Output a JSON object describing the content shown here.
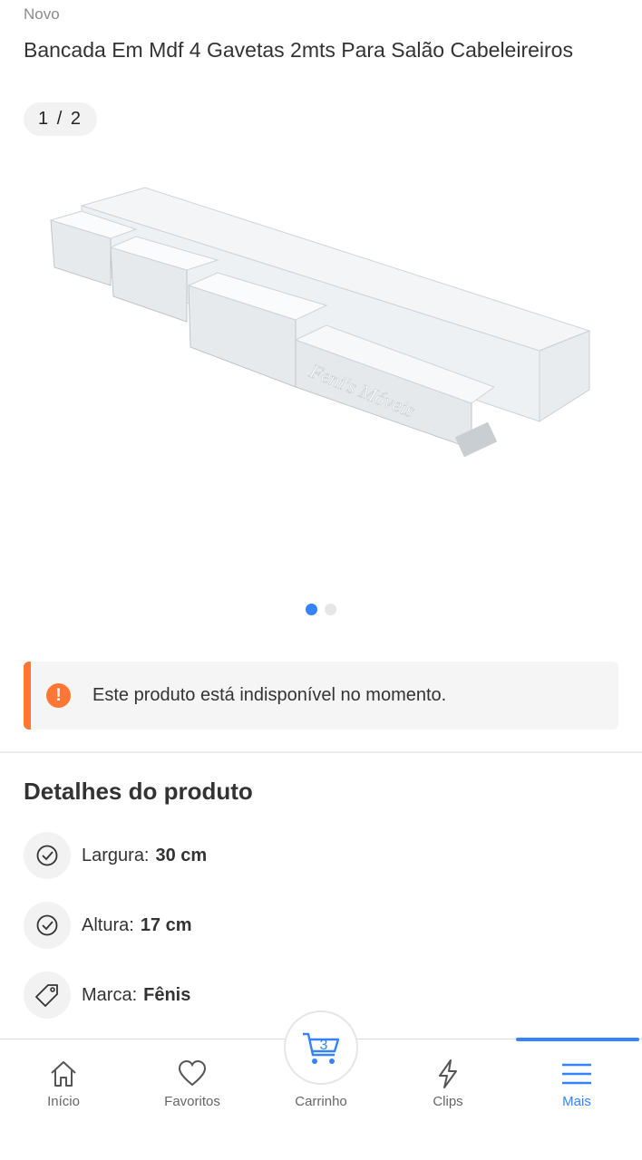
{
  "product": {
    "condition": "Novo",
    "title": "Bancada Em Mdf 4 Gavetas 2mts Para Salão Cabeleireiros",
    "image_counter": "1 / 2",
    "image_watermark": "Feni's Móveis",
    "gallery": {
      "total": 2,
      "active_index": 0
    }
  },
  "alert": {
    "icon": "exclamation-icon",
    "text": "Este produto está indisponível no momento.",
    "color": "#ff7733"
  },
  "details": {
    "title": "Detalhes do produto",
    "specs": [
      {
        "icon": "check-circle-icon",
        "label": "Largura:",
        "value": "30 cm"
      },
      {
        "icon": "check-circle-icon",
        "label": "Altura:",
        "value": "17 cm"
      },
      {
        "icon": "tag-icon",
        "label": "Marca:",
        "value": "Fênis"
      }
    ]
  },
  "nav": {
    "items": [
      {
        "label": "Início",
        "icon": "home-icon"
      },
      {
        "label": "Favoritos",
        "icon": "heart-icon"
      },
      {
        "label": "Carrinho",
        "icon": "cart-icon",
        "badge": "3"
      },
      {
        "label": "Clips",
        "icon": "lightning-icon"
      },
      {
        "label": "Mais",
        "icon": "menu-icon",
        "active": true
      }
    ]
  },
  "colors": {
    "accent": "#3483fa",
    "warning": "#ff7733",
    "text": "#333333"
  }
}
